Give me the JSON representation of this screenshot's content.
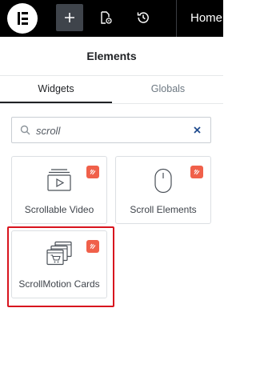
{
  "topbar": {
    "logo_icon": "elementor-logo-icon",
    "add_icon": "plus-icon",
    "page_settings_icon": "page-settings-icon",
    "history_icon": "history-icon",
    "page_label": "Home"
  },
  "panel": {
    "title": "Elements",
    "tabs": [
      {
        "label": "Widgets",
        "active": true
      },
      {
        "label": "Globals",
        "active": false
      }
    ]
  },
  "search": {
    "value": "scroll",
    "search_icon": "search-icon",
    "clear_icon": "close-icon"
  },
  "widgets": [
    {
      "label": "Scrollable Video",
      "icon": "video-player-icon",
      "badge_icon": "pro-badge-icon"
    },
    {
      "label": "Scroll Elements",
      "icon": "mouse-icon",
      "badge_icon": "pro-badge-icon"
    },
    {
      "label": "ScrollMotion Cards",
      "icon": "stacked-cards-cart-icon",
      "badge_icon": "pro-badge-icon",
      "highlighted": true
    }
  ],
  "colors": {
    "topbar_bg": "#000000",
    "badge": "#f0604a",
    "highlight_border": "#d8141e"
  }
}
